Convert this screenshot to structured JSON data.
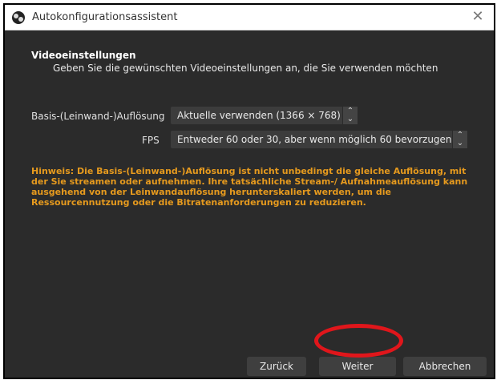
{
  "window": {
    "title": "Autokonfigurationsassistent",
    "close_glyph": "✕"
  },
  "section": {
    "title": "Videoeinstellungen",
    "subtitle": "Geben Sie die gewünschten Videoeinstellungen an, die Sie verwenden möchten"
  },
  "fields": {
    "resolution_label": "Basis-(Leinwand-)Auflösung",
    "resolution_value": "Aktuelle verwenden (1366 × 768)",
    "fps_label": "FPS",
    "fps_value": "Entweder 60 oder 30, aber wenn möglich 60 bevorzugen"
  },
  "hint": "Hinweis: Die Basis-(Leinwand-)Auflösung ist nicht unbedingt die gleiche Auflösung, mit der Sie streamen oder aufnehmen. Ihre tatsächliche Stream-/ Aufnahmeauflösung kann ausgehend von der Leinwandauflösung herunterskaliert werden, um die Ressourcennutzung oder die Bitratenanforderungen zu reduzieren.",
  "buttons": {
    "back": "Zurück",
    "next": "Weiter",
    "cancel": "Abbrechen"
  },
  "colors": {
    "background": "#2b2b2b",
    "hint": "#e69a1e",
    "highlight_ring": "#e0161b"
  }
}
